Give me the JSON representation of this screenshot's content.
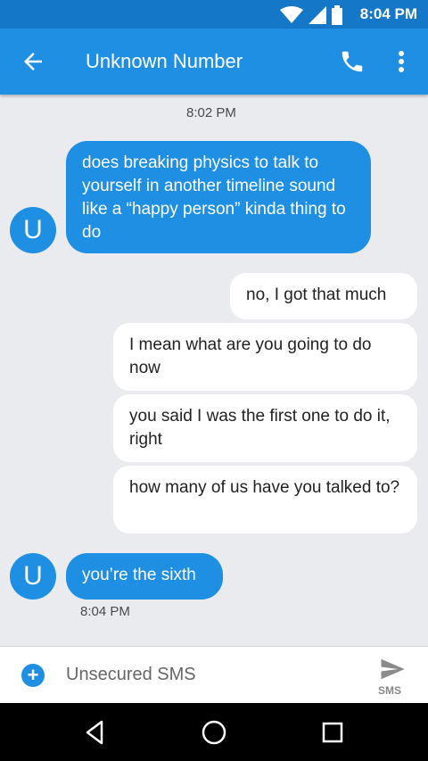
{
  "status": {
    "time": "8:04 PM"
  },
  "toolbar": {
    "title": "Unknown Number"
  },
  "conversation": {
    "timestamp_top": "8:02 PM",
    "avatar_letter": "U",
    "messages": [
      {
        "direction": "incoming",
        "text": "does breaking physics to talk to yourself in another timeline sound like a “happy person” kinda thing to do"
      },
      {
        "direction": "outgoing",
        "text": "no, I got that much"
      },
      {
        "direction": "outgoing",
        "text": "I mean what are you going to do now"
      },
      {
        "direction": "outgoing",
        "text": "you said I was the first one to do it, right"
      },
      {
        "direction": "outgoing",
        "text": "how many of us have you talked to?"
      },
      {
        "direction": "incoming",
        "text": "you’re the sixth"
      }
    ],
    "timestamp_bottom": "8:04 PM"
  },
  "composer": {
    "placeholder": "Unsecured SMS",
    "send_label": "SMS"
  },
  "colors": {
    "status_bar": "#1577c8",
    "toolbar": "#1e8fe3",
    "incoming_bubble": "#1e8fe3",
    "outgoing_bubble": "#ffffff",
    "background": "#e9ebef"
  },
  "icons": [
    "wifi-icon",
    "signal-icon",
    "battery-icon",
    "back-arrow-icon",
    "phone-icon",
    "more-vert-icon",
    "add-icon",
    "send-icon",
    "nav-back-icon",
    "nav-home-icon",
    "nav-recents-icon"
  ]
}
